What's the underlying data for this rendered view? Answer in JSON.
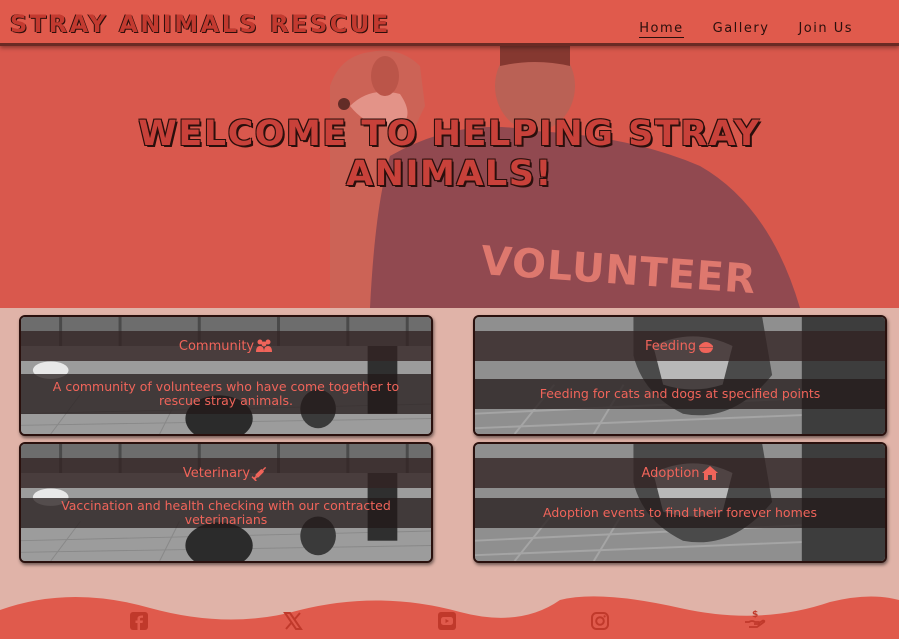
{
  "header": {
    "brand": "STRAY ANIMALS RESCUE",
    "nav": [
      {
        "label": "Home",
        "active": true
      },
      {
        "label": "Gallery",
        "active": false
      },
      {
        "label": "Join Us",
        "active": false
      }
    ]
  },
  "hero": {
    "title_line1": "WELCOME TO HELPING STRAY",
    "title_line2": "ANIMALS!",
    "shirt_text": "VOLUNTEER"
  },
  "services": [
    {
      "title": "Community",
      "icon": "users-icon",
      "description": "A community of volunteers who have come together to rescue stray animals."
    },
    {
      "title": "Feeding",
      "icon": "bowl-icon",
      "description": "Feeding for cats and dogs at specified points"
    },
    {
      "title": "Veterinary",
      "icon": "syringe-icon",
      "description": "Vaccination and health checking with our contracted veterinarians"
    },
    {
      "title": "Adoption",
      "icon": "house-icon",
      "description": "Adoption events to find their forever homes"
    }
  ],
  "footer": {
    "social": [
      "facebook-icon",
      "x-icon",
      "youtube-icon",
      "instagram-icon",
      "donate-icon"
    ]
  },
  "colors": {
    "primary": "#e05a4c",
    "accent_text": "#f0645a",
    "page_bg": "#e0b3a8",
    "dark": "#2a0f0c"
  }
}
